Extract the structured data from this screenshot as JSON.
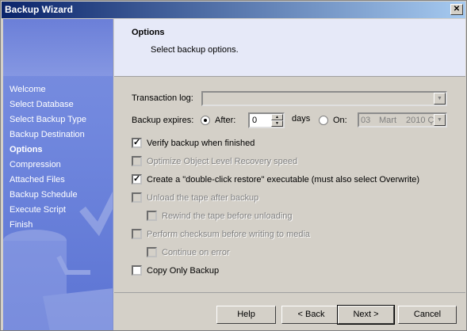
{
  "window": {
    "title": "Backup Wizard",
    "close_glyph": "✕"
  },
  "sidebar": {
    "items": [
      {
        "label": "Welcome",
        "active": false
      },
      {
        "label": "Select Database",
        "active": false
      },
      {
        "label": "Select Backup Type",
        "active": false
      },
      {
        "label": "Backup Destination",
        "active": false
      },
      {
        "label": "Options",
        "active": true
      },
      {
        "label": "Compression",
        "active": false
      },
      {
        "label": "Attached Files",
        "active": false
      },
      {
        "label": "Backup Schedule",
        "active": false
      },
      {
        "label": "Execute Script",
        "active": false
      },
      {
        "label": "Finish",
        "active": false
      }
    ]
  },
  "header": {
    "title": "Options",
    "subtitle": "Select backup options."
  },
  "options": {
    "transaction_log_label": "Transaction log:",
    "transaction_log_value": "",
    "backup_expires_label": "Backup expires:",
    "after_label": "After:",
    "after_selected": true,
    "days_value": "0",
    "days_label": "days",
    "on_label": "On:",
    "on_selected": false,
    "date_day": "03",
    "date_month": "Mart",
    "date_year": "2010 Ç",
    "checkboxes": [
      {
        "label": "Verify backup when finished",
        "checked": true,
        "enabled": true
      },
      {
        "label": "Optimize Object Level Recovery speed",
        "checked": false,
        "enabled": false
      },
      {
        "label": "Create a \"double-click restore\" executable (must also select Overwrite)",
        "checked": true,
        "enabled": true
      },
      {
        "label": "Unload the tape after backup",
        "checked": false,
        "enabled": false
      },
      {
        "label": "Rewind the tape before unloading",
        "checked": false,
        "enabled": false
      },
      {
        "label": "Perform checksum before writing to media",
        "checked": false,
        "enabled": false
      },
      {
        "label": "Continue on error",
        "checked": false,
        "enabled": false
      },
      {
        "label": "Copy Only Backup",
        "checked": false,
        "enabled": true
      }
    ]
  },
  "footer": {
    "help_label": "Help",
    "back_label": "< Back",
    "next_label": "Next >",
    "cancel_label": "Cancel"
  }
}
